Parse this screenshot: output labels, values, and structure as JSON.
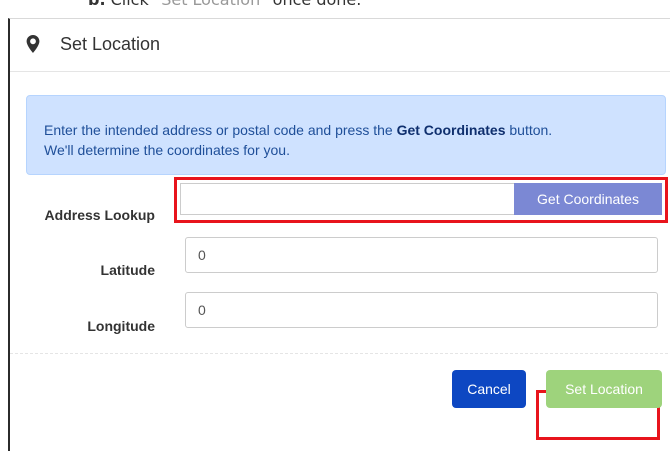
{
  "instruction": {
    "step": "b.",
    "text_before": " Click \"",
    "link_text": "Set Location",
    "text_after": "\" once done."
  },
  "modal": {
    "icon": "map-marker-icon",
    "title": "Set Location",
    "alert": {
      "text_1": "Enter the intended address or postal code and press the ",
      "bold": "Get Coordinates",
      "text_2": " button.",
      "text_3": "We'll determine the coordinates for you.",
      "background": "#cfe2ff"
    },
    "address_lookup": {
      "label": "Address Lookup",
      "value": "",
      "button": "Get Coordinates"
    },
    "latitude": {
      "label": "Latitude",
      "value": "0"
    },
    "longitude": {
      "label": "Longitude",
      "value": "0"
    },
    "footer": {
      "cancel": "Cancel",
      "set_location": "Set Location"
    },
    "highlight_color": "#e8141c"
  }
}
